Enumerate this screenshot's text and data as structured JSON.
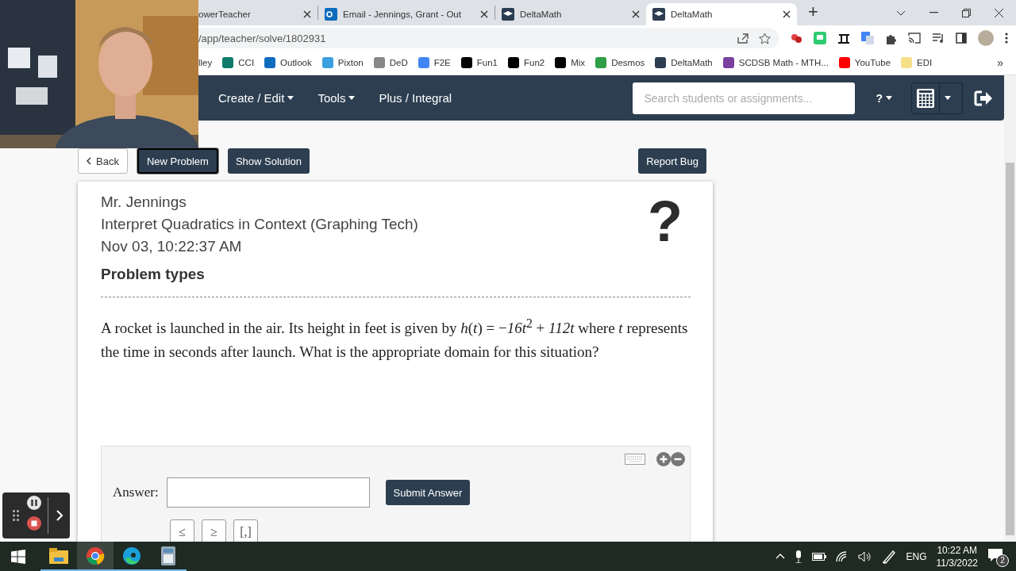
{
  "browser": {
    "tabs": [
      {
        "title": "owerTeacher",
        "selected": false,
        "kind": "plain"
      },
      {
        "title": "Email - Jennings, Grant - Out",
        "selected": false,
        "kind": "mail"
      },
      {
        "title": "DeltaMath",
        "selected": false,
        "kind": "site"
      },
      {
        "title": "DeltaMath",
        "selected": true,
        "kind": "site"
      }
    ],
    "new_tab": "+",
    "url": "/app/teacher/solve/1802931",
    "bookmarks": [
      {
        "label": "lley"
      },
      {
        "label": "CCI",
        "color": "#0f7b6c"
      },
      {
        "label": "Outlook",
        "color": "#0f6cbd"
      },
      {
        "label": "Pixton",
        "color": "#3aa0e0"
      },
      {
        "label": "DeD",
        "color": "#888888"
      },
      {
        "label": "F2E",
        "color": "#4285f4"
      },
      {
        "label": "Fun1",
        "color": "#000000"
      },
      {
        "label": "Fun2",
        "color": "#000000"
      },
      {
        "label": "Mix",
        "color": "#000000"
      },
      {
        "label": "Desmos",
        "color": "#2f9e44"
      },
      {
        "label": "DeltaMath",
        "color": "#2c3e50"
      },
      {
        "label": "SCDSB Math - MTH...",
        "color": "#7b3fa0"
      },
      {
        "label": "YouTube",
        "color": "#ff0000"
      },
      {
        "label": "EDI",
        "color": "#f6e08a"
      }
    ],
    "bookmarks_more": "»"
  },
  "navbar": {
    "menus": [
      {
        "label": "Create / Edit",
        "dropdown": true
      },
      {
        "label": "Tools",
        "dropdown": true
      },
      {
        "label": "Plus / Integral",
        "dropdown": false
      }
    ],
    "search": {
      "placeholder": "Search students or assignments..."
    },
    "help": "?"
  },
  "actions": [
    {
      "label": "Back",
      "kind": "back"
    },
    {
      "label": "New Problem",
      "kind": "focused"
    },
    {
      "label": "Show Solution",
      "kind": "dark"
    }
  ],
  "report_bug": "Report Bug",
  "card": {
    "teacher": "Mr. Jennings",
    "skill": "Interpret Quadratics in Context (Graphing Tech)",
    "timestamp": "Nov 03, 10:22:37 AM",
    "help_mark": "?",
    "section": "Problem types",
    "problem": "A rocket is launched in the air. Its height in feet is given by *h*(*t*) = −*16t*$^{2}$ + *112t* where *t* represents the time in seconds after launch. What is the appropriate domain for this situation?",
    "answer": {
      "label": "Answer:",
      "submit": "Submit Answer",
      "symbols": [
        "≤",
        "≥",
        "[,]"
      ]
    }
  },
  "taskbar": {
    "apps": [
      {
        "kind": "folder",
        "selected": false
      },
      {
        "kind": "chrome",
        "selected": true
      },
      {
        "kind": "edge",
        "selected": false
      },
      {
        "kind": "calculator",
        "selected": false
      }
    ],
    "language": "ENG",
    "time": "10:22 AM",
    "date": "11/3/2022",
    "notifications": "2"
  }
}
